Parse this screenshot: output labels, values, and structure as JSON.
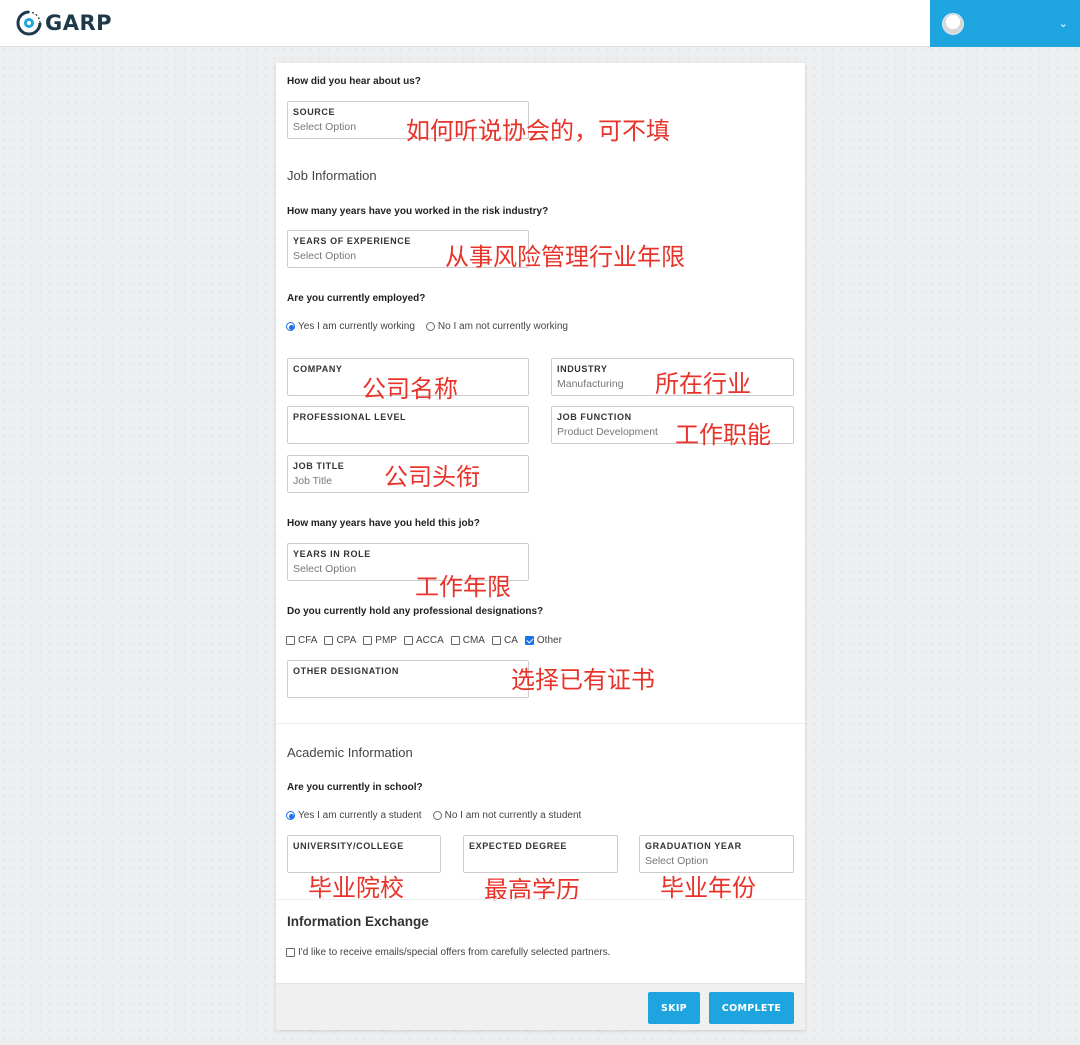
{
  "header": {
    "logo_text": "GARP",
    "brand_color": "#1ea5df"
  },
  "source": {
    "question": "How did you hear about us?",
    "field_label": "SOURCE",
    "field_value": "Select Option",
    "note": "如何听说协会的，可不填"
  },
  "job": {
    "section_title": "Job Information",
    "years_question": "How many years have you worked in the risk industry?",
    "years_label": "YEARS OF EXPERIENCE",
    "years_value": "Select Option",
    "years_note": "从事风险管理行业年限",
    "employed_question": "Are you currently employed?",
    "employed_yes": "Yes I am currently working",
    "employed_no": "No I am not currently working",
    "company_label": "COMPANY",
    "company_note": "公司名称",
    "industry_label": "INDUSTRY",
    "industry_value": "Manufacturing",
    "industry_note": "所在行业",
    "level_label": "PROFESSIONAL LEVEL",
    "function_label": "JOB FUNCTION",
    "function_value": "Product Development",
    "function_note": "工作职能",
    "title_label": "JOB TITLE",
    "title_placeholder": "Job Title",
    "title_note": "公司头衔",
    "role_question": "How many years have you held this job?",
    "role_label": "YEARS IN ROLE",
    "role_value": "Select Option",
    "role_note": "工作年限",
    "designation_question": "Do you currently hold any professional designations?",
    "designations": [
      "CFA",
      "CPA",
      "PMP",
      "ACCA",
      "CMA",
      "CA",
      "Other"
    ],
    "designation_checked": "Other",
    "other_label": "OTHER DESIGNATION",
    "other_note": "选择已有证书"
  },
  "academic": {
    "section_title": "Academic Information",
    "school_question": "Are you currently in school?",
    "school_yes": "Yes I am currently a student",
    "school_no": "No I am not currently a student",
    "university_label": "UNIVERSITY/COLLEGE",
    "university_note": "毕业院校",
    "degree_label": "EXPECTED DEGREE",
    "degree_note": "最高学历",
    "grad_label": "GRADUATION YEAR",
    "grad_value": "Select Option",
    "grad_note": "毕业年份"
  },
  "exchange": {
    "title": "Information Exchange",
    "consent": "I'd like to receive emails/special offers from carefully selected partners."
  },
  "actions": {
    "skip_label": "SKIP",
    "complete_label": "COMPLETE"
  }
}
